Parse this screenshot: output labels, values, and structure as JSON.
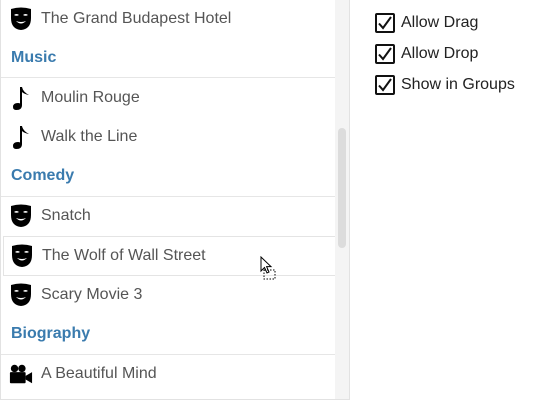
{
  "list": {
    "items": [
      {
        "kind": "item",
        "icon": "drama-mask-icon",
        "label": "The Grand Budapest Hotel"
      },
      {
        "kind": "group",
        "label": "Music"
      },
      {
        "kind": "item",
        "icon": "music-note-icon",
        "label": "Moulin Rouge"
      },
      {
        "kind": "item",
        "icon": "music-note-icon",
        "label": "Walk the Line"
      },
      {
        "kind": "group",
        "label": "Comedy"
      },
      {
        "kind": "item",
        "icon": "drama-mask-icon",
        "label": "Snatch"
      },
      {
        "kind": "item",
        "icon": "drama-mask-icon",
        "label": "The Wolf of Wall Street",
        "hover": true
      },
      {
        "kind": "item",
        "icon": "drama-mask-icon",
        "label": "Scary Movie 3"
      },
      {
        "kind": "group",
        "label": "Biography"
      },
      {
        "kind": "item",
        "icon": "video-camera-icon",
        "label": "A Beautiful Mind"
      }
    ]
  },
  "options": [
    {
      "label": "Allow Drag",
      "checked": true
    },
    {
      "label": "Allow Drop",
      "checked": true
    },
    {
      "label": "Show in Groups",
      "checked": true
    }
  ]
}
